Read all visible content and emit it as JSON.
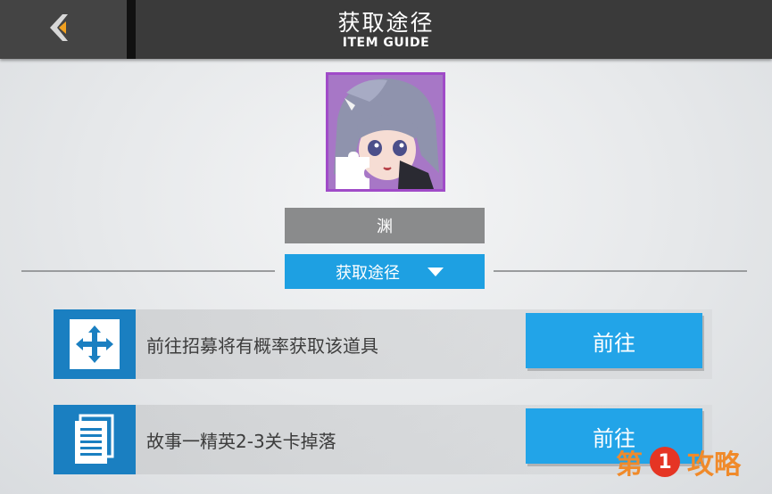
{
  "header": {
    "title": "获取途径",
    "subtitle": "ITEM GUIDE",
    "back_icon": "back-arrow-icon"
  },
  "item": {
    "name": "渊",
    "portrait_type": "character-portrait",
    "badge_icon": "puzzle-piece-icon",
    "border_color": "#a04bc8"
  },
  "dropdown": {
    "label": "获取途径",
    "icon": "chevron-down-icon"
  },
  "sources": [
    {
      "icon": "recruit-cross-icon",
      "text": "前往招募将有概率获取该道具",
      "button": "前往"
    },
    {
      "icon": "document-icon",
      "text": "故事一精英2-3关卡掉落",
      "button": "前往"
    }
  ],
  "watermark": {
    "prefix": "第",
    "number": "1",
    "suffix": "攻略"
  },
  "colors": {
    "accent": "#1ea0e2",
    "icon_bg": "#1a7fc1",
    "header_bg": "#3a3a3a"
  }
}
